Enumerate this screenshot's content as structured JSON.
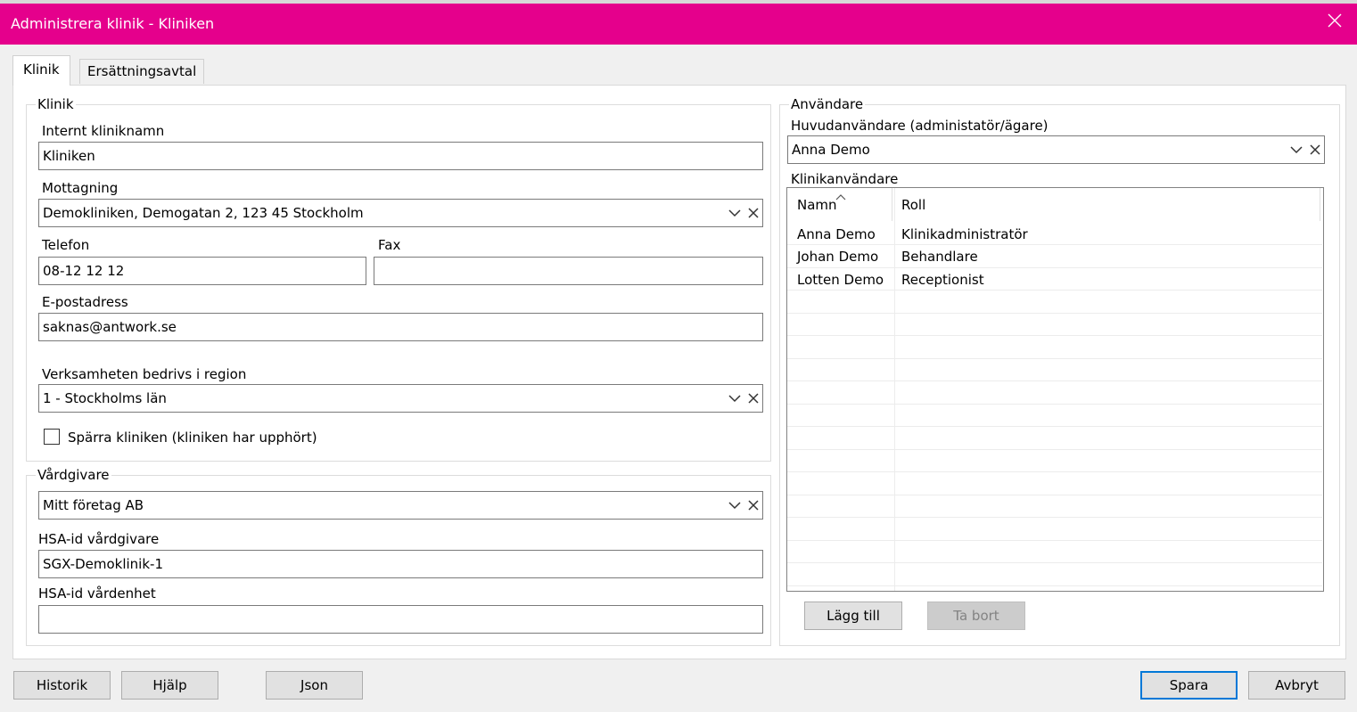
{
  "window": {
    "title": "Administrera klinik - Kliniken",
    "accent_color": "#e5008c"
  },
  "tabs": [
    {
      "label": "Klinik",
      "active": true
    },
    {
      "label": "Ersättningsavtal",
      "active": false
    }
  ],
  "klinik": {
    "legend": "Klinik",
    "internal_name": {
      "label": "Internt kliniknamn",
      "value": "Kliniken"
    },
    "reception": {
      "label": "Mottagning",
      "value": "Demokliniken, Demogatan 2, 123 45 Stockholm"
    },
    "phone": {
      "label": "Telefon",
      "value": "08-12 12 12"
    },
    "fax": {
      "label": "Fax",
      "value": ""
    },
    "email": {
      "label": "E-postadress",
      "value": "saknas@antwork.se"
    },
    "region": {
      "label": "Verksamheten bedrivs i region",
      "value": "1 - Stockholms län"
    },
    "block_checkbox": {
      "label": "Spärra kliniken (kliniken har upphört)",
      "checked": false
    }
  },
  "vardgivare": {
    "legend": "Vårdgivare",
    "provider": {
      "value": "Mitt företag AB"
    },
    "hsa_provider": {
      "label": "HSA-id vårdgivare",
      "value": "SGX-Demoklinik-1"
    },
    "hsa_unit": {
      "label": "HSA-id vårdenhet",
      "value": ""
    }
  },
  "users": {
    "legend": "Användare",
    "main_user": {
      "label": "Huvudanvändare (administatör/ägare)",
      "value": "Anna Demo"
    },
    "clinic_users_label": "Klinikanvändare",
    "columns": [
      "Namn",
      "Roll"
    ],
    "rows": [
      {
        "name": "Anna Demo",
        "role": "Klinikadministratör"
      },
      {
        "name": "Johan Demo",
        "role": "Behandlare"
      },
      {
        "name": "Lotten Demo",
        "role": "Receptionist"
      }
    ],
    "add_button": "Lägg till",
    "remove_button": "Ta bort"
  },
  "footer": {
    "history_button": "Historik",
    "help_button": "Hjälp",
    "json_button": "Json",
    "save_button": "Spara",
    "cancel_button": "Avbryt"
  }
}
